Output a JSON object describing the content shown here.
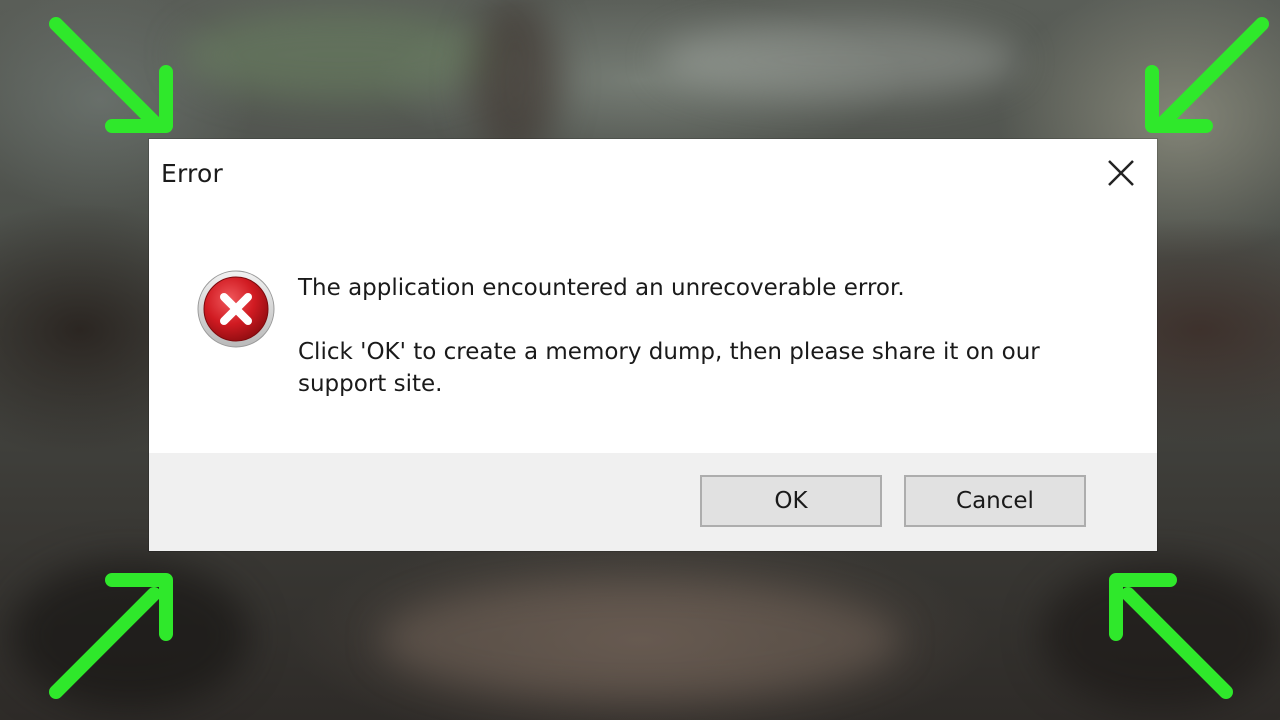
{
  "dialog": {
    "title": "Error",
    "close_icon": "close-icon",
    "status_icon": "error-icon",
    "message_line1": "The application encountered an unrecoverable error.",
    "message_line2": "Click 'OK' to create a memory dump, then please share it on our support site.",
    "ok_label": "OK",
    "cancel_label": "Cancel"
  },
  "overlay": {
    "arrow_icon": "arrow-icon",
    "arrow_color": "#2fe82b"
  },
  "colors": {
    "error_red": "#c8141a",
    "footer_bg": "#f0f0f0"
  }
}
